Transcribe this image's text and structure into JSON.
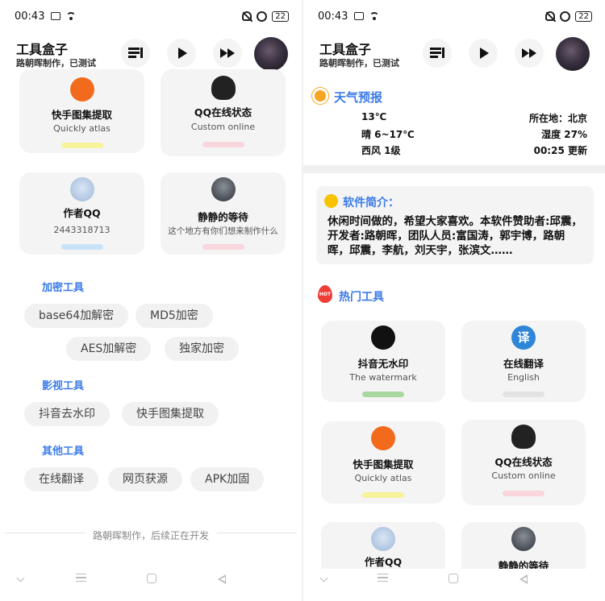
{
  "status": {
    "time": "00:43",
    "battery": "22"
  },
  "app": {
    "title": "工具盒子",
    "subtitle": "路朝晖制作，已测试"
  },
  "left": {
    "cards": [
      {
        "title": "快手图集提取",
        "subtitle": "Quickly atlas",
        "bar_color": "#f6f39a",
        "icon": "kuaishou-icon"
      },
      {
        "title": "QQ在线状态",
        "subtitle": "Custom online",
        "bar_color": "#f8d6db",
        "icon": "qq-penguin-icon"
      },
      {
        "title": "作者QQ",
        "subtitle": "2443318713",
        "bar_color": "#c9e2f7",
        "icon": "author-avatar-icon"
      },
      {
        "title": "静静的等待",
        "subtitle": "这个地方有你们想来制作什么",
        "bar_color": "#f8d6db",
        "icon": "wait-avatar-icon"
      }
    ],
    "sections": [
      {
        "title": "加密工具",
        "chips": [
          "base64加解密",
          "MD5加密",
          "AES加解密",
          "独家加密"
        ]
      },
      {
        "title": "影视工具",
        "chips": [
          "抖音去水印",
          "快手图集提取"
        ]
      },
      {
        "title": "其他工具",
        "chips": [
          "在线翻译",
          "网页获源",
          "APK加固"
        ]
      }
    ],
    "footer": "路朝晖制作，后续正在开发"
  },
  "right": {
    "weather": {
      "title": "天气预报",
      "temp": "13℃",
      "location": "所在地：北京",
      "condition": "晴 6~17℃",
      "humidity": "湿度 27%",
      "wind": "西风 1级",
      "updated": "00:25 更新"
    },
    "intro": {
      "title": "软件简介：",
      "text": "休闲时间做的，希望大家喜欢。本软件赞助者:邱震，开发者:路朝晖，团队人员:富国涛，郭宇博，路朝晖，邱震，李航，刘天宇，张滨文……"
    },
    "hot": {
      "title": "热门工具",
      "icon_label": "HOT",
      "cards": [
        {
          "title": "抖音无水印",
          "subtitle": "The watermark",
          "bar_color": "#a8d8a0",
          "icon": "douyin-icon"
        },
        {
          "title": "在线翻译",
          "subtitle": "English",
          "bar_color": "#e3e3e3",
          "icon": "translate-icon",
          "icon_text": "译"
        },
        {
          "title": "快手图集提取",
          "subtitle": "Quickly atlas",
          "bar_color": "#f6f39a",
          "icon": "kuaishou-icon"
        },
        {
          "title": "QQ在线状态",
          "subtitle": "Custom online",
          "bar_color": "#f8d6db",
          "icon": "qq-penguin-icon"
        },
        {
          "title": "作者QQ",
          "subtitle": "",
          "bar_color": "",
          "icon": "author-avatar-icon"
        },
        {
          "title": "静静的等待",
          "subtitle": "",
          "bar_color": "",
          "icon": "wait-avatar-icon"
        }
      ]
    }
  },
  "colors": {
    "accent": "#3b7be8",
    "card_bg": "#f4f4f4",
    "chip_bg": "#f1f1f1"
  }
}
